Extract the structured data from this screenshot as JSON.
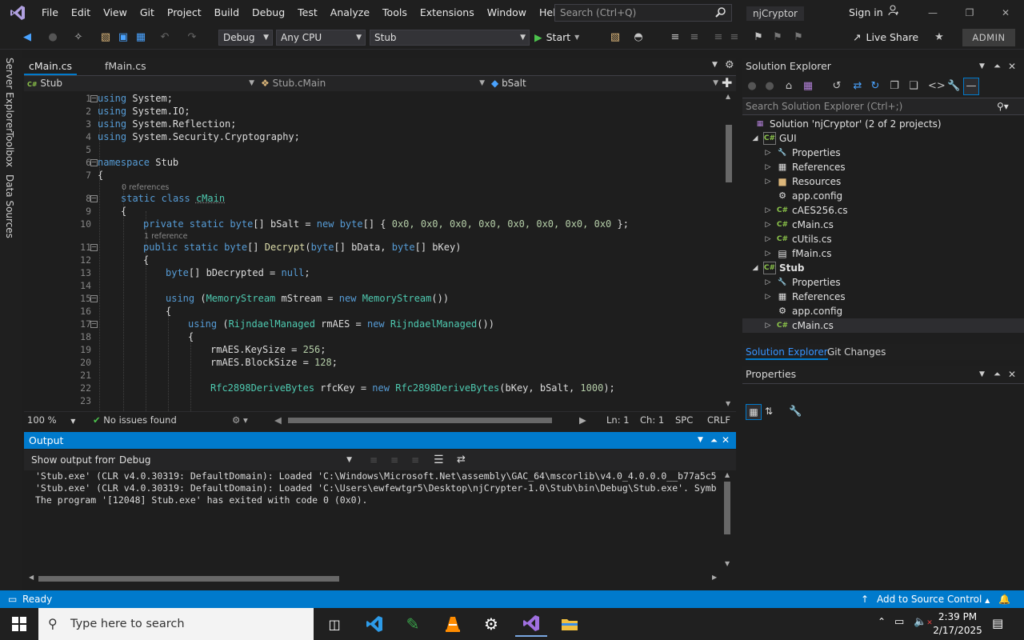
{
  "menu": [
    "File",
    "Edit",
    "View",
    "Git",
    "Project",
    "Build",
    "Debug",
    "Test",
    "Analyze",
    "Tools",
    "Extensions",
    "Window",
    "Help"
  ],
  "search_placeholder": "Search (Ctrl+Q)",
  "solution_name": "njCryptor",
  "sign_in": "Sign in",
  "toolbar": {
    "config": "Debug",
    "platform": "Any CPU",
    "startup_project": "Stub",
    "start_label": "Start",
    "live_share": "Live Share",
    "admin": "ADMIN"
  },
  "left_tabs": [
    "Server Explorer",
    "Toolbox",
    "Data Sources"
  ],
  "doc_tabs": [
    "cMain.cs",
    "fMain.cs"
  ],
  "nav": {
    "project": "Stub",
    "class": "Stub.cMain",
    "member": "bSalt"
  },
  "code": {
    "line_numbers": [
      "1",
      "2",
      "3",
      "4",
      "5",
      "6",
      "7",
      "8",
      "9",
      "10",
      "11",
      "12",
      "13",
      "14",
      "15",
      "16",
      "17",
      "18",
      "19",
      "20",
      "21",
      "22",
      "23"
    ],
    "codelens_0": "0 references",
    "codelens_1": "1 reference",
    "l1_kw": "using",
    "l1_rest": " System;",
    "l2_kw": "using",
    "l2_rest": " System.IO;",
    "l3_kw": "using",
    "l3_rest": " System.Reflection;",
    "l4_kw": "using",
    "l4_rest": " System.Security.Cryptography;",
    "l6_kw": "namespace",
    "l6_rest": " Stub",
    "brace_open": "{",
    "l8_kw": "static class",
    "l8_cls": "cMain",
    "l10_kw": "private static",
    "l10_t1": "byte",
    "l10_a": "[] bSalt = ",
    "l10_new": "new",
    "l10_t2": "byte",
    "l10_b": "[] { ",
    "l10_vals": "0x0, 0x0, 0x0, 0x0, 0x0, 0x0, 0x0, 0x0",
    "l10_end": " };",
    "l11_kw": "public static",
    "l11_t1": "byte",
    "l11_a": "[] ",
    "l11_fn": "Decrypt",
    "l11_b": "(",
    "l11_t2": "byte",
    "l11_c": "[] bData, ",
    "l11_t3": "byte",
    "l11_d": "[] bKey)",
    "l13_t": "byte",
    "l13_a": "[] bDecrypted = ",
    "l13_null": "null",
    "l13_end": ";",
    "l15_kw": "using",
    "l15_a": " (",
    "l15_t": "MemoryStream",
    "l15_b": " mStream = ",
    "l15_new": "new",
    "l15_t2": "MemoryStream",
    "l15_end": "())",
    "l17_kw": "using",
    "l17_a": " (",
    "l17_t": "RijndaelManaged",
    "l17_b": " rmAES = ",
    "l17_new": "new",
    "l17_t2": "RijndaelManaged",
    "l17_end": "())",
    "l19_a": "rmAES.KeySize = ",
    "l19_n": "256",
    "l19_end": ";",
    "l20_a": "rmAES.BlockSize = ",
    "l20_n": "128",
    "l20_end": ";",
    "l22_t": "Rfc2898DeriveBytes",
    "l22_a": " rfcKey = ",
    "l22_new": "new",
    "l22_t2": "Rfc2898DeriveBytes",
    "l22_b": "(bKey, bSalt, ",
    "l22_n": "1000",
    "l22_end": ");"
  },
  "editor_status": {
    "zoom": "100 %",
    "issues": "No issues found",
    "line": "Ln: 1",
    "col": "Ch: 1",
    "spc": "SPC",
    "crlf": "CRLF"
  },
  "output": {
    "title": "Output",
    "show_from_label": "Show output from:",
    "source": "Debug",
    "lines": [
      "'Stub.exe' (CLR v4.0.30319: DefaultDomain): Loaded 'C:\\Windows\\Microsoft.Net\\assembly\\GAC_64\\mscorlib\\v4.0_4.0.0.0__b77a5c5",
      "'Stub.exe' (CLR v4.0.30319: DefaultDomain): Loaded 'C:\\Users\\ewfewtgr5\\Desktop\\njCrypter-1.0\\Stub\\bin\\Debug\\Stub.exe'. Symb",
      "The program '[12048] Stub.exe' has exited with code 0 (0x0)."
    ]
  },
  "solution_explorer": {
    "title": "Solution Explorer",
    "search_placeholder": "Search Solution Explorer (Ctrl+;)",
    "solution": "Solution 'njCryptor' (2 of 2 projects)",
    "gui": "GUI",
    "gui_items": [
      "Properties",
      "References",
      "Resources",
      "app.config",
      "cAES256.cs",
      "cMain.cs",
      "cUtils.cs",
      "fMain.cs"
    ],
    "stub": "Stub",
    "stub_items": [
      "Properties",
      "References",
      "app.config",
      "cMain.cs"
    ],
    "tabs": [
      "Solution Explorer",
      "Git Changes"
    ]
  },
  "properties": {
    "title": "Properties"
  },
  "status": {
    "ready": "Ready",
    "source_control": "Add to Source Control"
  },
  "taskbar": {
    "search": "Type here to search",
    "time": "2:39 PM",
    "date": "2/17/2025"
  },
  "colors": {
    "accent": "#007acc",
    "keyword": "#569cd6",
    "type": "#4ec9b0",
    "number": "#b5cea8",
    "method": "#dcdcaa"
  }
}
